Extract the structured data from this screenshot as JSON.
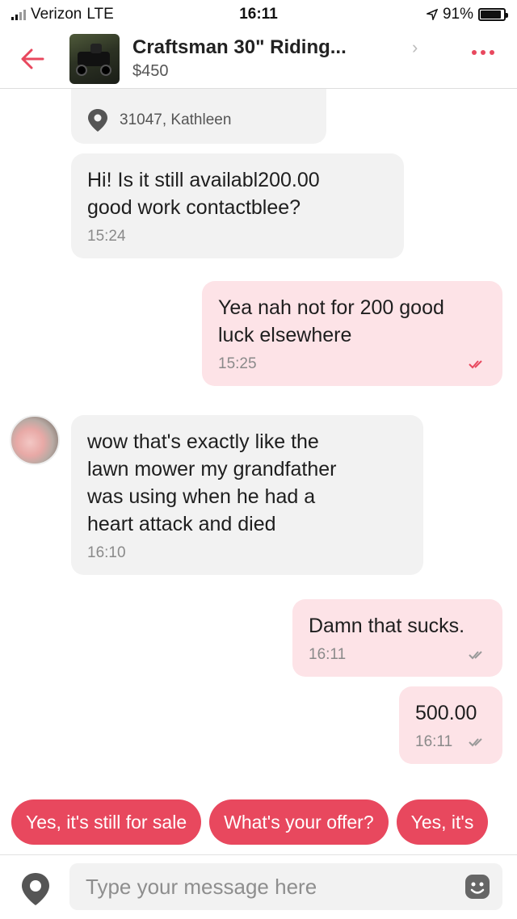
{
  "status_bar": {
    "carrier": "Verizon",
    "network": "LTE",
    "time": "16:11",
    "battery_text": "91%",
    "battery_level": 0.91
  },
  "header": {
    "title": "Craftsman 30\" Riding...",
    "price": "$450",
    "back_icon": "arrow-left-icon",
    "chevron_icon": "chevron-right-icon",
    "more_icon": "more-dots-icon"
  },
  "location_card": {
    "location": "31047, Kathleen"
  },
  "messages": [
    {
      "direction": "incoming",
      "lines": [
        "Hi! Is it still availabl200.00",
        "good work contactblee?"
      ],
      "time": "15:24"
    },
    {
      "direction": "outgoing",
      "lines": [
        "Yea nah not for 200 good",
        "luck elsewhere"
      ],
      "time": "15:25"
    },
    {
      "direction": "incoming",
      "lines": [
        "wow that's exactly like the",
        "lawn mower my grandfather",
        "was using when he had a",
        "heart attack and died"
      ],
      "time": "16:10"
    },
    {
      "direction": "outgoing",
      "lines": [
        "Damn that sucks."
      ],
      "time": "16:11"
    },
    {
      "direction": "outgoing",
      "lines": [
        "500.00"
      ],
      "time": "16:11"
    }
  ],
  "quick_replies": [
    "Yes, it's still for sale",
    "What's your offer?",
    "Yes, it's"
  ],
  "composer": {
    "placeholder": "Type your message here",
    "location_icon": "location-pin-icon",
    "emoji_icon": "emoji-icon"
  },
  "colors": {
    "accent": "#e8485e",
    "incoming_bubble": "#f2f2f2",
    "outgoing_bubble": "#fde3e7"
  }
}
